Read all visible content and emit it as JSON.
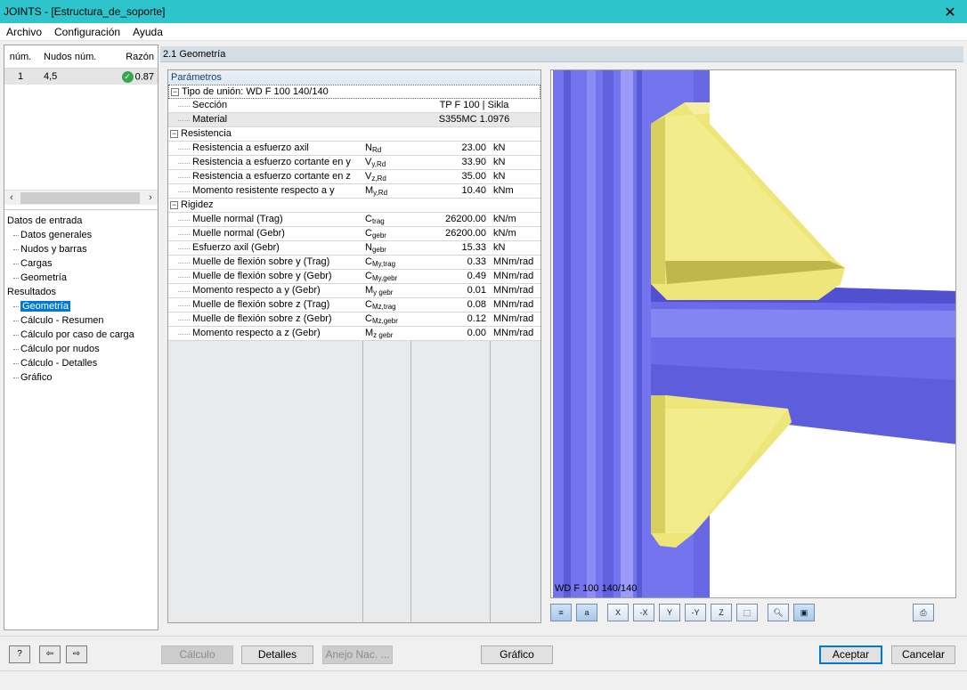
{
  "window": {
    "title": "JOINTS - [Estructura_de_soporte]"
  },
  "menu": [
    "Archivo",
    "Configuración",
    "Ayuda"
  ],
  "nodes_table": {
    "headers": [
      "núm.",
      "Nudos núm.",
      "Razón"
    ],
    "rows": [
      {
        "num": "1",
        "nodes": "4,5",
        "ratio": "0.87"
      }
    ]
  },
  "nav": {
    "input_header": "Datos de entrada",
    "input_items": [
      "Datos generales",
      "Nudos y barras",
      "Cargas",
      "Geometría"
    ],
    "results_header": "Resultados",
    "results_items": [
      "Geometría",
      "Cálculo - Resumen",
      "Cálculo por caso de carga",
      "Cálculo por nudos",
      "Cálculo - Detalles",
      "Gráfico"
    ],
    "selected": "Geometría"
  },
  "section_title": "2.1 Geometría",
  "params": {
    "title": "Parámetros",
    "joint_type": "Tipo de unión: WD F 100 140/140",
    "section": {
      "label": "Sección",
      "value": "TP F 100 | Sikla"
    },
    "material": {
      "label": "Material",
      "value": "S355MC 1.0976"
    },
    "resistance_header": "Resistencia",
    "resistance": [
      {
        "name": "Resistencia a esfuerzo axil",
        "sym": "N",
        "sub": "Rd",
        "value": "23.00",
        "unit": "kN"
      },
      {
        "name": "Resistencia a esfuerzo cortante en y",
        "sym": "V",
        "sub": "y,Rd",
        "value": "33.90",
        "unit": "kN"
      },
      {
        "name": "Resistencia a esfuerzo cortante en z",
        "sym": "V",
        "sub": "z,Rd",
        "value": "35.00",
        "unit": "kN"
      },
      {
        "name": "Momento resistente respecto a y",
        "sym": "M",
        "sub": "y,Rd",
        "value": "10.40",
        "unit": "kNm"
      }
    ],
    "stiffness_header": "Rigidez",
    "stiffness": [
      {
        "name": "Muelle normal (Trag)",
        "sym": "C",
        "sub": "trag",
        "value": "26200.00",
        "unit": "kN/m"
      },
      {
        "name": "Muelle normal (Gebr)",
        "sym": "C",
        "sub": "gebr",
        "value": "26200.00",
        "unit": "kN/m"
      },
      {
        "name": "Esfuerzo axil (Gebr)",
        "sym": "N",
        "sub": "gebr",
        "value": "15.33",
        "unit": "kN"
      },
      {
        "name": "Muelle de flexión sobre y (Trag)",
        "sym": "C",
        "sub": "My,trag",
        "value": "0.33",
        "unit": "MNm/rad"
      },
      {
        "name": "Muelle de flexión sobre y (Gebr)",
        "sym": "C",
        "sub": "My,gebr",
        "value": "0.49",
        "unit": "MNm/rad"
      },
      {
        "name": "Momento respecto a y (Gebr)",
        "sym": "M",
        "sub": "y gebr",
        "value": "0.01",
        "unit": "MNm/rad"
      },
      {
        "name": "Muelle de flexión sobre z (Trag)",
        "sym": "C",
        "sub": "Mz,trag",
        "value": "0.08",
        "unit": "MNm/rad"
      },
      {
        "name": "Muelle de flexión sobre z (Gebr)",
        "sym": "C",
        "sub": "Mz,gebr",
        "value": "0.12",
        "unit": "MNm/rad"
      },
      {
        "name": "Momento respecto a z (Gebr)",
        "sym": "M",
        "sub": "z gebr",
        "value": "0.00",
        "unit": "MNm/rad"
      }
    ]
  },
  "view": {
    "label": "WD F 100 140/140"
  },
  "view_toolbar": [
    "show-values-icon",
    "show-labels-icon",
    "view-x-icon",
    "view-minus-x-icon",
    "view-y-icon",
    "view-minus-y-icon",
    "view-z-icon",
    "isometric-icon",
    "zoom-icon",
    "transparent-icon",
    "print-icon"
  ],
  "view_toolbar_labels": {
    "x": "X",
    "mx": "-X",
    "y": "Y",
    "my": "-Y",
    "z": "Z"
  },
  "buttons": {
    "calc": "Cálculo",
    "details": "Detalles",
    "annex": "Anejo Nac. ...",
    "graphic": "Gráfico",
    "accept": "Aceptar",
    "cancel": "Cancelar"
  },
  "colors": {
    "titlebar": "#2ec4cb",
    "beam": "#6e6ef0",
    "plate": "#f1ea7a",
    "selection": "#0078d7"
  }
}
